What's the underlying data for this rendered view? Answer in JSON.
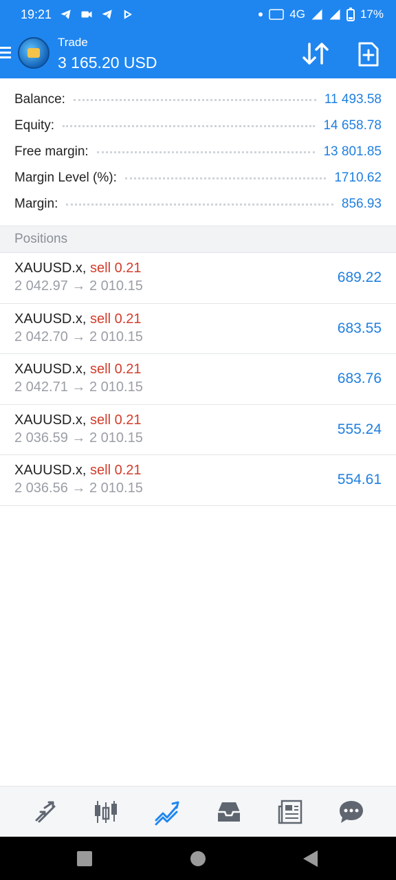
{
  "status_bar": {
    "time": "19:21",
    "network": "4G",
    "battery": "17%"
  },
  "header": {
    "title": "Trade",
    "balance": "3 165.20 USD"
  },
  "summary": [
    {
      "label": "Balance:",
      "value": "11 493.58"
    },
    {
      "label": "Equity:",
      "value": "14 658.78"
    },
    {
      "label": "Free margin:",
      "value": "13 801.85"
    },
    {
      "label": "Margin Level (%):",
      "value": "1710.62"
    },
    {
      "label": "Margin:",
      "value": "856.93"
    }
  ],
  "positions_title": "Positions",
  "positions": [
    {
      "symbol": "XAUUSD.x,",
      "type": "sell 0.21",
      "prices": "2 042.97 → 2 010.15",
      "profit": "689.22"
    },
    {
      "symbol": "XAUUSD.x,",
      "type": "sell 0.21",
      "prices": "2 042.70 → 2 010.15",
      "profit": "683.55"
    },
    {
      "symbol": "XAUUSD.x,",
      "type": "sell 0.21",
      "prices": "2 042.71 → 2 010.15",
      "profit": "683.76"
    },
    {
      "symbol": "XAUUSD.x,",
      "type": "sell 0.21",
      "prices": "2 036.59 → 2 010.15",
      "profit": "555.24"
    },
    {
      "symbol": "XAUUSD.x,",
      "type": "sell 0.21",
      "prices": "2 036.56 → 2 010.15",
      "profit": "554.61"
    }
  ],
  "colors": {
    "primary": "#1f86f0",
    "profit": "#1f7fe0",
    "sell": "#d33c2a"
  },
  "bottom_nav": [
    {
      "icon": "quotes-icon"
    },
    {
      "icon": "chart-icon"
    },
    {
      "icon": "trade-icon",
      "active": true
    },
    {
      "icon": "history-icon"
    },
    {
      "icon": "news-icon"
    },
    {
      "icon": "messages-icon"
    }
  ]
}
